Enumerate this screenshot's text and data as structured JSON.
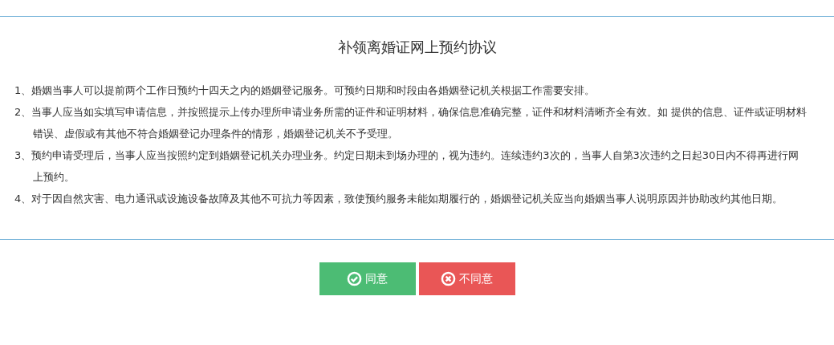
{
  "title": "补领离婚证网上预约协议",
  "clauses": [
    "1、婚姻当事人可以提前两个工作日预约十四天之内的婚姻登记服务。可预约日期和时段由各婚姻登记机关根据工作需要安排。",
    "2、当事人应当如实填写申请信息，并按照提示上传办理所申请业务所需的证件和证明材料，确保信息准确完整，证件和材料清晰齐全有效。如 提供的信息、证件或证明材料错误、虚假或有其他不符合婚姻登记办理条件的情形，婚姻登记机关不予受理。",
    "3、预约申请受理后，当事人应当按照约定到婚姻登记机关办理业务。约定日期未到场办理的，视为违约。连续违约3次的，当事人自第3次违约之日起30日内不得再进行网上预约。",
    "4、对于因自然灾害、电力通讯或设施设备故障及其他不可抗力等因素，致使预约服务未能如期履行的，婚姻登记机关应当向婚姻当事人说明原因并协助改约其他日期。"
  ],
  "buttons": [
    {
      "kind": "agree",
      "label": "同意"
    },
    {
      "kind": "disagree",
      "label": "不同意"
    }
  ]
}
